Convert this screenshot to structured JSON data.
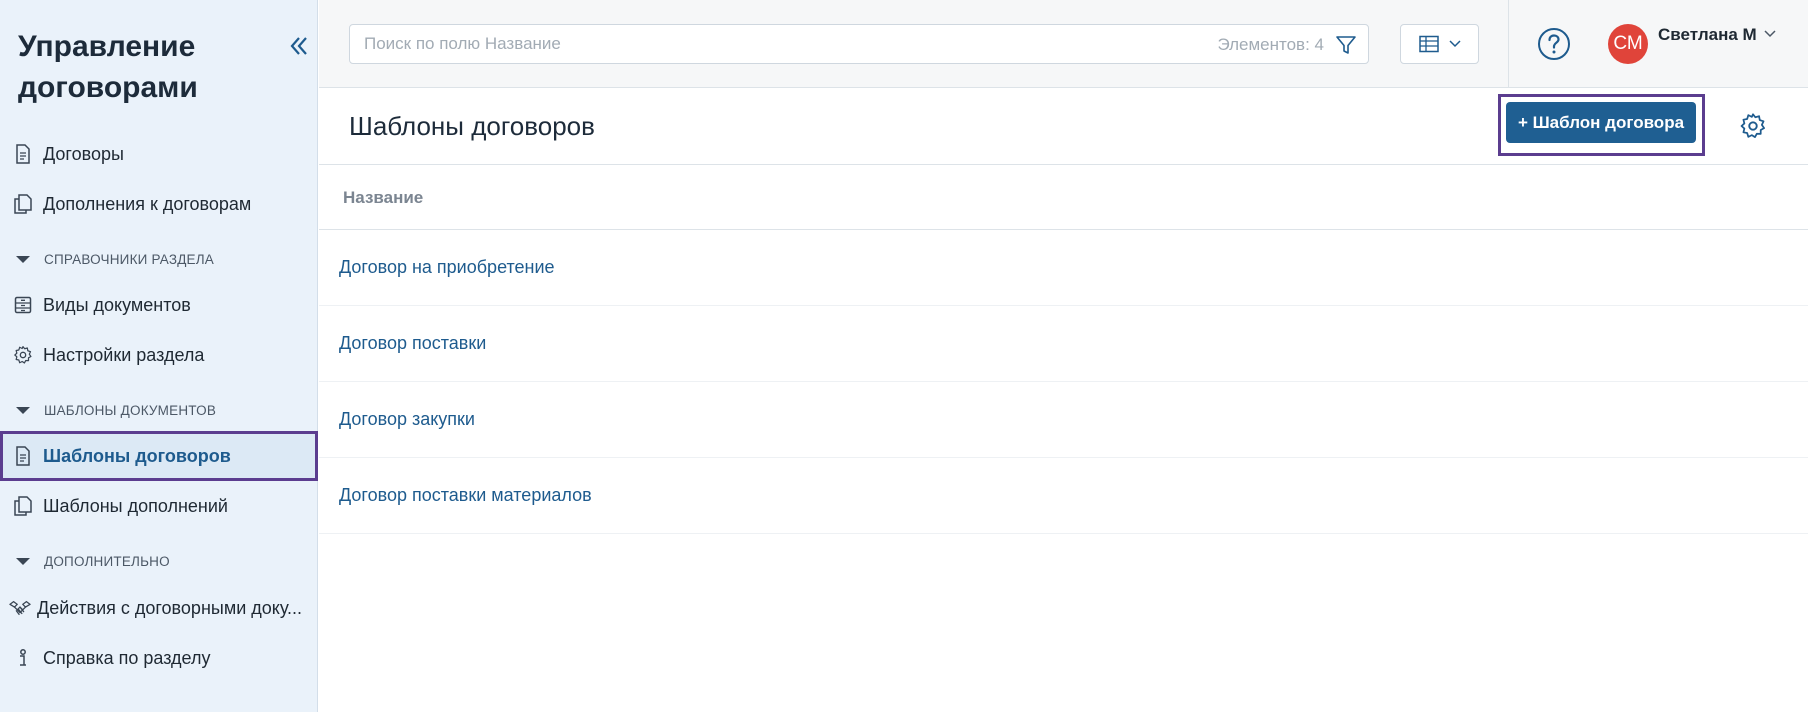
{
  "sidebar": {
    "title": "Управление договорами",
    "items": [
      {
        "label": "Договоры"
      },
      {
        "label": "Дополнения к договорам"
      },
      {
        "label": "Виды документов"
      },
      {
        "label": "Настройки раздела"
      },
      {
        "label": "Шаблоны договоров"
      },
      {
        "label": "Шаблоны дополнений"
      },
      {
        "label": "Действия с договорными доку..."
      },
      {
        "label": "Справка по разделу"
      }
    ],
    "sections": [
      {
        "label": "СПРАВОЧНИКИ РАЗДЕЛА"
      },
      {
        "label": "ШАБЛОНЫ ДОКУМЕНТОВ"
      },
      {
        "label": "ДОПОЛНИТЕЛЬНО"
      }
    ]
  },
  "search": {
    "placeholder": "Поиск по полю Название",
    "count_label": "Элементов: 4"
  },
  "user": {
    "initials": "СМ",
    "name": "Светлана М"
  },
  "page": {
    "title": "Шаблоны договоров",
    "add_button_label": "+ Шаблон договора"
  },
  "table": {
    "column_header": "Название",
    "rows": [
      {
        "name": "Договор на приобретение"
      },
      {
        "name": "Договор поставки"
      },
      {
        "name": "Договор закупки"
      },
      {
        "name": "Договор поставки материалов"
      }
    ]
  },
  "colors": {
    "accent": "#1f5f92",
    "highlight_frame": "#5b3d8f",
    "avatar": "#e0443a",
    "sidebar_bg": "#eaf2fa"
  }
}
